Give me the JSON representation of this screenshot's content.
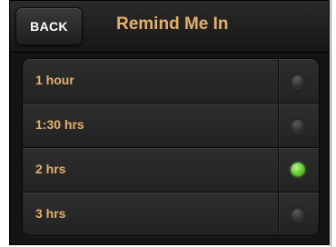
{
  "header": {
    "back_label": "BACK",
    "title": "Remind Me In"
  },
  "options": [
    {
      "label": "1 hour",
      "selected": false
    },
    {
      "label": "1:30 hrs",
      "selected": false
    },
    {
      "label": "2 hrs",
      "selected": true
    },
    {
      "label": "3 hrs",
      "selected": false
    }
  ],
  "colors": {
    "accent_text": "#e6b06b",
    "selected_indicator": "#5ec22d",
    "background": "#141414"
  }
}
